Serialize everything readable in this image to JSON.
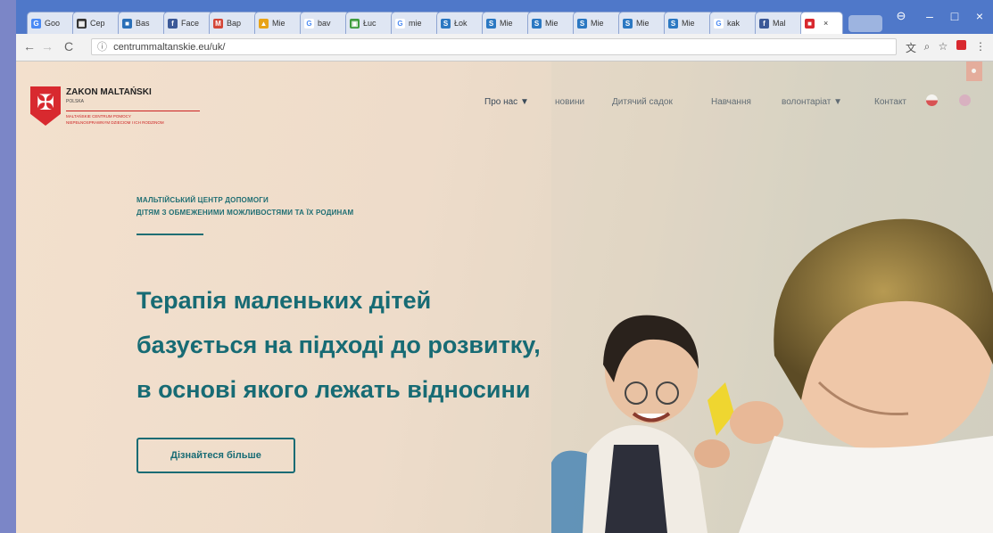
{
  "browser": {
    "tabs": [
      {
        "label": "Goo",
        "color": "#4a8af4",
        "glyph": "G"
      },
      {
        "label": "Cep",
        "color": "#333333",
        "glyph": "▦"
      },
      {
        "label": "Bas",
        "color": "#2a6fb8",
        "glyph": "■"
      },
      {
        "label": "Face",
        "color": "#3b5998",
        "glyph": "f"
      },
      {
        "label": "Bap",
        "color": "#d44638",
        "glyph": "M"
      },
      {
        "label": "Mie",
        "color": "#e8a317",
        "glyph": "▲"
      },
      {
        "label": "bav",
        "color": "#ffffff",
        "glyph": "G"
      },
      {
        "label": "Łuc",
        "color": "#3e9c3e",
        "glyph": "▣"
      },
      {
        "label": "mie",
        "color": "#ffffff",
        "glyph": "G"
      },
      {
        "label": "Łok",
        "color": "#2b78c2",
        "glyph": "S"
      },
      {
        "label": "Mie",
        "color": "#2b78c2",
        "glyph": "S"
      },
      {
        "label": "Mie",
        "color": "#2b78c2",
        "glyph": "S"
      },
      {
        "label": "Mie",
        "color": "#2b78c2",
        "glyph": "S"
      },
      {
        "label": "Mie",
        "color": "#2b78c2",
        "glyph": "S"
      },
      {
        "label": "Mie",
        "color": "#2b78c2",
        "glyph": "S"
      },
      {
        "label": "kak",
        "color": "#ffffff",
        "glyph": "G"
      },
      {
        "label": "Mal",
        "color": "#3b5998",
        "glyph": "f"
      },
      {
        "label": "",
        "color": "#d8292f",
        "glyph": "■"
      }
    ],
    "active_tab_close": "×",
    "window_controls": [
      "–",
      "□",
      "×"
    ],
    "profile_icon": "user-circle-icon",
    "url": "centrummaltanskie.eu/uk/",
    "nav": {
      "back": "←",
      "forward": "→",
      "reload": "C",
      "info": "ⓘ"
    }
  },
  "site": {
    "org_name": "ZAKON MALTAŃSKI",
    "org_country": "POLSKA",
    "org_sub1": "MALTAŃSKIE CENTRUM POMOCY",
    "org_sub2": "NIEPEŁNOSPRAWNYM DZIECIOM I ICH RODZINOM",
    "menu": [
      "Про нас ▼",
      "новини",
      "Дитячий садок",
      "Навчання",
      "волонтаріат ▼",
      "Контакт"
    ],
    "eyebrow_line1": "МАЛЬТІЙСЬКИЙ ЦЕНТР ДОПОМОГИ",
    "eyebrow_line2": "ДІТЯМ З ОБМЕЖЕНИМИ МОЖЛИВОСТЯМИ ТА ЇХ РОДИНАМ",
    "headline": [
      "Терапія маленьких дітей",
      "базується на підході до розвитку,",
      "в основі якого лежать відносини"
    ],
    "cta": "Дізнайтеся більше"
  },
  "colors": {
    "brand_red": "#d8292f",
    "teal": "#176b74",
    "page_bg": "#f0decb",
    "frame_border": "#7b86c7",
    "tab_strip": "#4f78c9"
  }
}
